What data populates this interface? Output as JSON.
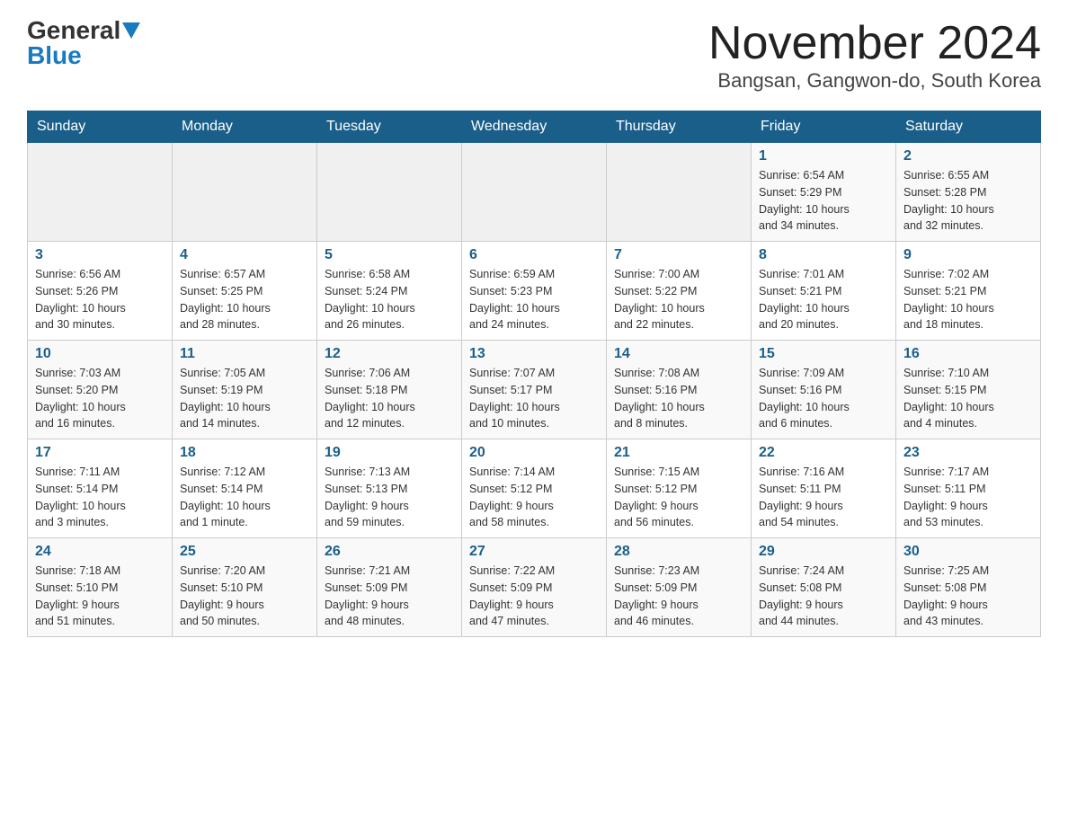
{
  "logo": {
    "general": "General",
    "blue": "Blue"
  },
  "title": "November 2024",
  "location": "Bangsan, Gangwon-do, South Korea",
  "days_of_week": [
    "Sunday",
    "Monday",
    "Tuesday",
    "Wednesday",
    "Thursday",
    "Friday",
    "Saturday"
  ],
  "weeks": [
    [
      {
        "day": "",
        "info": ""
      },
      {
        "day": "",
        "info": ""
      },
      {
        "day": "",
        "info": ""
      },
      {
        "day": "",
        "info": ""
      },
      {
        "day": "",
        "info": ""
      },
      {
        "day": "1",
        "info": "Sunrise: 6:54 AM\nSunset: 5:29 PM\nDaylight: 10 hours\nand 34 minutes."
      },
      {
        "day": "2",
        "info": "Sunrise: 6:55 AM\nSunset: 5:28 PM\nDaylight: 10 hours\nand 32 minutes."
      }
    ],
    [
      {
        "day": "3",
        "info": "Sunrise: 6:56 AM\nSunset: 5:26 PM\nDaylight: 10 hours\nand 30 minutes."
      },
      {
        "day": "4",
        "info": "Sunrise: 6:57 AM\nSunset: 5:25 PM\nDaylight: 10 hours\nand 28 minutes."
      },
      {
        "day": "5",
        "info": "Sunrise: 6:58 AM\nSunset: 5:24 PM\nDaylight: 10 hours\nand 26 minutes."
      },
      {
        "day": "6",
        "info": "Sunrise: 6:59 AM\nSunset: 5:23 PM\nDaylight: 10 hours\nand 24 minutes."
      },
      {
        "day": "7",
        "info": "Sunrise: 7:00 AM\nSunset: 5:22 PM\nDaylight: 10 hours\nand 22 minutes."
      },
      {
        "day": "8",
        "info": "Sunrise: 7:01 AM\nSunset: 5:21 PM\nDaylight: 10 hours\nand 20 minutes."
      },
      {
        "day": "9",
        "info": "Sunrise: 7:02 AM\nSunset: 5:21 PM\nDaylight: 10 hours\nand 18 minutes."
      }
    ],
    [
      {
        "day": "10",
        "info": "Sunrise: 7:03 AM\nSunset: 5:20 PM\nDaylight: 10 hours\nand 16 minutes."
      },
      {
        "day": "11",
        "info": "Sunrise: 7:05 AM\nSunset: 5:19 PM\nDaylight: 10 hours\nand 14 minutes."
      },
      {
        "day": "12",
        "info": "Sunrise: 7:06 AM\nSunset: 5:18 PM\nDaylight: 10 hours\nand 12 minutes."
      },
      {
        "day": "13",
        "info": "Sunrise: 7:07 AM\nSunset: 5:17 PM\nDaylight: 10 hours\nand 10 minutes."
      },
      {
        "day": "14",
        "info": "Sunrise: 7:08 AM\nSunset: 5:16 PM\nDaylight: 10 hours\nand 8 minutes."
      },
      {
        "day": "15",
        "info": "Sunrise: 7:09 AM\nSunset: 5:16 PM\nDaylight: 10 hours\nand 6 minutes."
      },
      {
        "day": "16",
        "info": "Sunrise: 7:10 AM\nSunset: 5:15 PM\nDaylight: 10 hours\nand 4 minutes."
      }
    ],
    [
      {
        "day": "17",
        "info": "Sunrise: 7:11 AM\nSunset: 5:14 PM\nDaylight: 10 hours\nand 3 minutes."
      },
      {
        "day": "18",
        "info": "Sunrise: 7:12 AM\nSunset: 5:14 PM\nDaylight: 10 hours\nand 1 minute."
      },
      {
        "day": "19",
        "info": "Sunrise: 7:13 AM\nSunset: 5:13 PM\nDaylight: 9 hours\nand 59 minutes."
      },
      {
        "day": "20",
        "info": "Sunrise: 7:14 AM\nSunset: 5:12 PM\nDaylight: 9 hours\nand 58 minutes."
      },
      {
        "day": "21",
        "info": "Sunrise: 7:15 AM\nSunset: 5:12 PM\nDaylight: 9 hours\nand 56 minutes."
      },
      {
        "day": "22",
        "info": "Sunrise: 7:16 AM\nSunset: 5:11 PM\nDaylight: 9 hours\nand 54 minutes."
      },
      {
        "day": "23",
        "info": "Sunrise: 7:17 AM\nSunset: 5:11 PM\nDaylight: 9 hours\nand 53 minutes."
      }
    ],
    [
      {
        "day": "24",
        "info": "Sunrise: 7:18 AM\nSunset: 5:10 PM\nDaylight: 9 hours\nand 51 minutes."
      },
      {
        "day": "25",
        "info": "Sunrise: 7:20 AM\nSunset: 5:10 PM\nDaylight: 9 hours\nand 50 minutes."
      },
      {
        "day": "26",
        "info": "Sunrise: 7:21 AM\nSunset: 5:09 PM\nDaylight: 9 hours\nand 48 minutes."
      },
      {
        "day": "27",
        "info": "Sunrise: 7:22 AM\nSunset: 5:09 PM\nDaylight: 9 hours\nand 47 minutes."
      },
      {
        "day": "28",
        "info": "Sunrise: 7:23 AM\nSunset: 5:09 PM\nDaylight: 9 hours\nand 46 minutes."
      },
      {
        "day": "29",
        "info": "Sunrise: 7:24 AM\nSunset: 5:08 PM\nDaylight: 9 hours\nand 44 minutes."
      },
      {
        "day": "30",
        "info": "Sunrise: 7:25 AM\nSunset: 5:08 PM\nDaylight: 9 hours\nand 43 minutes."
      }
    ]
  ]
}
